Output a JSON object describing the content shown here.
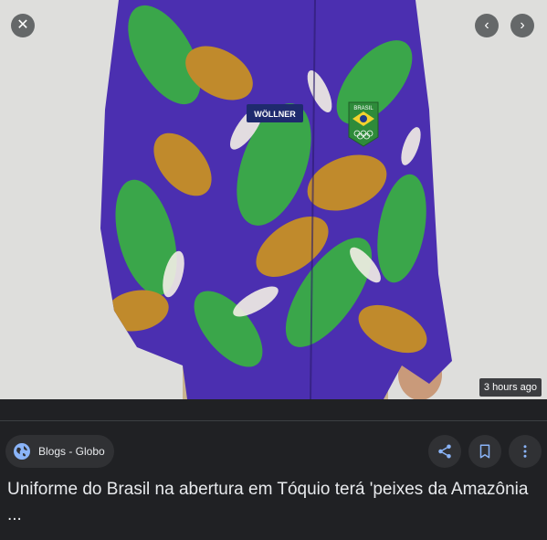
{
  "image": {
    "alt": "Uniforme do Brasil na abertura em Tóquio",
    "badge_text": "3 hours ago",
    "brand_patch": "WÖLLNER",
    "flag_patch": "BRASIL"
  },
  "controls": {
    "close_icon": "close-icon",
    "prev_icon": "chevron-left-icon",
    "next_icon": "chevron-right-icon"
  },
  "source": {
    "label": "Blogs - Globo",
    "icon": "globe-icon"
  },
  "actions": [
    {
      "icon": "share-icon"
    },
    {
      "icon": "bookmark-icon"
    },
    {
      "icon": "more-vert-icon"
    }
  ],
  "article": {
    "title": "Uniforme do Brasil na abertura em Tóquio terá 'peixes da Amazônia ..."
  },
  "colors": {
    "background": "#202124",
    "chip": "#303134",
    "accent_blue": "#8ab4f8",
    "shirt_purple": "#4b2fb0",
    "shirt_green": "#3aa64a",
    "shirt_ochre": "#c08a2c"
  }
}
